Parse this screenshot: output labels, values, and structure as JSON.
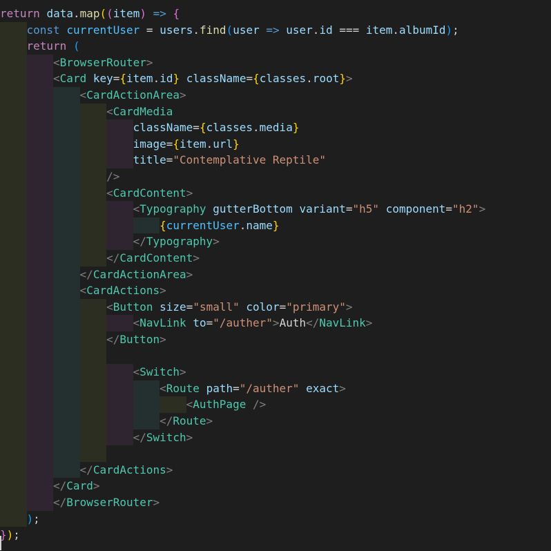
{
  "editor": {
    "colors": {
      "background": "#1e1e1e",
      "indent_guide_1": "#2c2e22",
      "indent_guide_2": "#2e2530",
      "indent_guide_3": "#243030",
      "keyword": "#c586c0",
      "declaration": "#569cd6",
      "function": "#dcdcaa",
      "variable": "#9cdcfe",
      "constant": "#4fc1ff",
      "tag": "#4ec9b0",
      "attribute": "#9cdcfe",
      "string": "#ce9178",
      "punctuation": "#808080",
      "text": "#d4d4d4",
      "bracket_gold": "#ffd700",
      "bracket_pink": "#da70d6",
      "bracket_blue": "#179fff"
    },
    "lines": [
      {
        "indent": 0,
        "tokens": [
          [
            "return",
            "keyword"
          ],
          [
            " ",
            "text"
          ],
          [
            "data",
            "variable"
          ],
          [
            ".",
            "text"
          ],
          [
            "map",
            "function"
          ],
          [
            "(",
            "bracket_gold"
          ],
          [
            "(",
            "bracket_pink"
          ],
          [
            "item",
            "variable"
          ],
          [
            ")",
            "bracket_pink"
          ],
          [
            " ",
            "text"
          ],
          [
            "=>",
            "declaration"
          ],
          [
            " ",
            "text"
          ],
          [
            "{",
            "bracket_pink"
          ]
        ]
      },
      {
        "indent": 1,
        "tokens": [
          [
            "const",
            "declaration"
          ],
          [
            " ",
            "text"
          ],
          [
            "currentUser",
            "constant"
          ],
          [
            " = ",
            "text"
          ],
          [
            "users",
            "variable"
          ],
          [
            ".",
            "text"
          ],
          [
            "find",
            "function"
          ],
          [
            "(",
            "bracket_blue"
          ],
          [
            "user",
            "variable"
          ],
          [
            " ",
            "text"
          ],
          [
            "=>",
            "declaration"
          ],
          [
            " ",
            "text"
          ],
          [
            "user",
            "variable"
          ],
          [
            ".",
            "text"
          ],
          [
            "id",
            "variable"
          ],
          [
            " === ",
            "text"
          ],
          [
            "item",
            "variable"
          ],
          [
            ".",
            "text"
          ],
          [
            "albumId",
            "variable"
          ],
          [
            ")",
            "bracket_blue"
          ],
          [
            ";",
            "text"
          ]
        ]
      },
      {
        "indent": 1,
        "tokens": [
          [
            "return",
            "keyword"
          ],
          [
            " ",
            "text"
          ],
          [
            "(",
            "bracket_blue"
          ]
        ]
      },
      {
        "indent": 2,
        "tokens": [
          [
            "<",
            "punctuation"
          ],
          [
            "BrowserRouter",
            "tag"
          ],
          [
            ">",
            "punctuation"
          ]
        ]
      },
      {
        "indent": 2,
        "tokens": [
          [
            "<",
            "punctuation"
          ],
          [
            "Card",
            "tag"
          ],
          [
            " ",
            "text"
          ],
          [
            "key",
            "attribute"
          ],
          [
            "=",
            "text"
          ],
          [
            "{",
            "bracket_gold"
          ],
          [
            "item",
            "variable"
          ],
          [
            ".",
            "text"
          ],
          [
            "id",
            "variable"
          ],
          [
            "}",
            "bracket_gold"
          ],
          [
            " ",
            "text"
          ],
          [
            "className",
            "attribute"
          ],
          [
            "=",
            "text"
          ],
          [
            "{",
            "bracket_gold"
          ],
          [
            "classes",
            "variable"
          ],
          [
            ".",
            "text"
          ],
          [
            "root",
            "variable"
          ],
          [
            "}",
            "bracket_gold"
          ],
          [
            ">",
            "punctuation"
          ]
        ]
      },
      {
        "indent": 3,
        "tokens": [
          [
            "<",
            "punctuation"
          ],
          [
            "CardActionArea",
            "tag"
          ],
          [
            ">",
            "punctuation"
          ]
        ]
      },
      {
        "indent": 4,
        "tokens": [
          [
            "<",
            "punctuation"
          ],
          [
            "CardMedia",
            "tag"
          ]
        ]
      },
      {
        "indent": 5,
        "tokens": [
          [
            "className",
            "attribute"
          ],
          [
            "=",
            "text"
          ],
          [
            "{",
            "bracket_gold"
          ],
          [
            "classes",
            "variable"
          ],
          [
            ".",
            "text"
          ],
          [
            "media",
            "variable"
          ],
          [
            "}",
            "bracket_gold"
          ]
        ]
      },
      {
        "indent": 5,
        "tokens": [
          [
            "image",
            "attribute"
          ],
          [
            "=",
            "text"
          ],
          [
            "{",
            "bracket_gold"
          ],
          [
            "item",
            "variable"
          ],
          [
            ".",
            "text"
          ],
          [
            "url",
            "variable"
          ],
          [
            "}",
            "bracket_gold"
          ]
        ]
      },
      {
        "indent": 5,
        "tokens": [
          [
            "title",
            "attribute"
          ],
          [
            "=",
            "text"
          ],
          [
            "\"Contemplative Reptile\"",
            "string"
          ]
        ]
      },
      {
        "indent": 4,
        "tokens": [
          [
            "/>",
            "punctuation"
          ]
        ]
      },
      {
        "indent": 4,
        "tokens": [
          [
            "<",
            "punctuation"
          ],
          [
            "CardContent",
            "tag"
          ],
          [
            ">",
            "punctuation"
          ]
        ]
      },
      {
        "indent": 5,
        "tokens": [
          [
            "<",
            "punctuation"
          ],
          [
            "Typography",
            "tag"
          ],
          [
            " ",
            "text"
          ],
          [
            "gutterBottom",
            "attribute"
          ],
          [
            " ",
            "text"
          ],
          [
            "variant",
            "attribute"
          ],
          [
            "=",
            "text"
          ],
          [
            "\"h5\"",
            "string"
          ],
          [
            " ",
            "text"
          ],
          [
            "component",
            "attribute"
          ],
          [
            "=",
            "text"
          ],
          [
            "\"h2\"",
            "string"
          ],
          [
            ">",
            "punctuation"
          ]
        ]
      },
      {
        "indent": 6,
        "tokens": [
          [
            "{",
            "bracket_gold"
          ],
          [
            "currentUser",
            "constant"
          ],
          [
            ".",
            "text"
          ],
          [
            "name",
            "variable"
          ],
          [
            "}",
            "bracket_gold"
          ]
        ]
      },
      {
        "indent": 5,
        "tokens": [
          [
            "</",
            "punctuation"
          ],
          [
            "Typography",
            "tag"
          ],
          [
            ">",
            "punctuation"
          ]
        ]
      },
      {
        "indent": 4,
        "tokens": [
          [
            "</",
            "punctuation"
          ],
          [
            "CardContent",
            "tag"
          ],
          [
            ">",
            "punctuation"
          ]
        ]
      },
      {
        "indent": 3,
        "tokens": [
          [
            "</",
            "punctuation"
          ],
          [
            "CardActionArea",
            "tag"
          ],
          [
            ">",
            "punctuation"
          ]
        ]
      },
      {
        "indent": 3,
        "tokens": [
          [
            "<",
            "punctuation"
          ],
          [
            "CardActions",
            "tag"
          ],
          [
            ">",
            "punctuation"
          ]
        ]
      },
      {
        "indent": 4,
        "tokens": [
          [
            "<",
            "punctuation"
          ],
          [
            "Button",
            "tag"
          ],
          [
            " ",
            "text"
          ],
          [
            "size",
            "attribute"
          ],
          [
            "=",
            "text"
          ],
          [
            "\"small\"",
            "string"
          ],
          [
            " ",
            "text"
          ],
          [
            "color",
            "attribute"
          ],
          [
            "=",
            "text"
          ],
          [
            "\"primary\"",
            "string"
          ],
          [
            ">",
            "punctuation"
          ]
        ]
      },
      {
        "indent": 5,
        "tokens": [
          [
            "<",
            "punctuation"
          ],
          [
            "NavLink",
            "tag"
          ],
          [
            " ",
            "text"
          ],
          [
            "to",
            "attribute"
          ],
          [
            "=",
            "text"
          ],
          [
            "\"/auther\"",
            "string"
          ],
          [
            ">",
            "punctuation"
          ],
          [
            "Auth",
            "text"
          ],
          [
            "</",
            "punctuation"
          ],
          [
            "NavLink",
            "tag"
          ],
          [
            ">",
            "punctuation"
          ]
        ]
      },
      {
        "indent": 4,
        "tokens": [
          [
            "</",
            "punctuation"
          ],
          [
            "Button",
            "tag"
          ],
          [
            ">",
            "punctuation"
          ]
        ]
      },
      {
        "indent": 4,
        "tokens": []
      },
      {
        "indent": 5,
        "tokens": [
          [
            "<",
            "punctuation"
          ],
          [
            "Switch",
            "tag"
          ],
          [
            ">",
            "punctuation"
          ]
        ]
      },
      {
        "indent": 6,
        "tokens": [
          [
            "<",
            "punctuation"
          ],
          [
            "Route",
            "tag"
          ],
          [
            " ",
            "text"
          ],
          [
            "path",
            "attribute"
          ],
          [
            "=",
            "text"
          ],
          [
            "\"/auther\"",
            "string"
          ],
          [
            " ",
            "text"
          ],
          [
            "exact",
            "attribute"
          ],
          [
            ">",
            "punctuation"
          ]
        ]
      },
      {
        "indent": 7,
        "tokens": [
          [
            "<",
            "punctuation"
          ],
          [
            "AuthPage",
            "tag"
          ],
          [
            " ",
            "text"
          ],
          [
            "/>",
            "punctuation"
          ]
        ]
      },
      {
        "indent": 6,
        "tokens": [
          [
            "</",
            "punctuation"
          ],
          [
            "Route",
            "tag"
          ],
          [
            ">",
            "punctuation"
          ]
        ]
      },
      {
        "indent": 5,
        "tokens": [
          [
            "</",
            "punctuation"
          ],
          [
            "Switch",
            "tag"
          ],
          [
            ">",
            "punctuation"
          ]
        ]
      },
      {
        "indent": 4,
        "tokens": []
      },
      {
        "indent": 3,
        "tokens": [
          [
            "</",
            "punctuation"
          ],
          [
            "CardActions",
            "tag"
          ],
          [
            ">",
            "punctuation"
          ]
        ]
      },
      {
        "indent": 2,
        "tokens": [
          [
            "</",
            "punctuation"
          ],
          [
            "Card",
            "tag"
          ],
          [
            ">",
            "punctuation"
          ]
        ]
      },
      {
        "indent": 2,
        "tokens": [
          [
            "</",
            "punctuation"
          ],
          [
            "BrowserRouter",
            "tag"
          ],
          [
            ">",
            "punctuation"
          ]
        ]
      },
      {
        "indent": 1,
        "tokens": [
          [
            ")",
            "bracket_blue"
          ],
          [
            ";",
            "text"
          ]
        ]
      },
      {
        "indent": 0,
        "tokens": [
          [
            "}",
            "bracket_pink"
          ],
          [
            ")",
            "bracket_gold"
          ],
          [
            ";",
            "text"
          ]
        ]
      }
    ]
  }
}
